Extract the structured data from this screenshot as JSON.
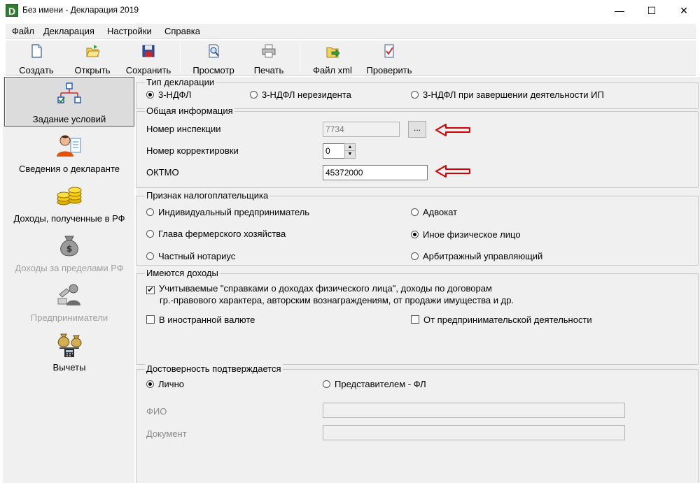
{
  "window": {
    "title": "Без имени - Декларация 2019",
    "icon_letter": "D",
    "minimize": "—",
    "maximize": "☐",
    "close": "✕"
  },
  "menu": [
    "Файл",
    "Декларация",
    "Настройки",
    "Справка"
  ],
  "toolbar": {
    "create": "Создать",
    "open": "Открыть",
    "save": "Сохранить",
    "preview": "Просмотр",
    "print": "Печать",
    "xml_file": "Файл xml",
    "check": "Проверить"
  },
  "nav": [
    {
      "label": "Задание условий",
      "icon": "structure-icon",
      "active": true,
      "disabled": false
    },
    {
      "label": "Сведения о декларанте",
      "icon": "person-icon",
      "active": false,
      "disabled": false
    },
    {
      "label": "Доходы, полученные в РФ",
      "icon": "coins-icon",
      "active": false,
      "disabled": false
    },
    {
      "label": "Доходы за пределами РФ",
      "icon": "money-bag-icon",
      "active": false,
      "disabled": true
    },
    {
      "label": "Предприниматели",
      "icon": "entrepreneur-icon",
      "active": false,
      "disabled": true
    },
    {
      "label": "Вычеты",
      "icon": "calculator-icon",
      "active": false,
      "disabled": false
    }
  ],
  "declaration_type": {
    "title": "Тип декларации",
    "options": [
      "3-НДФЛ",
      "3-НДФЛ нерезидента",
      "3-НДФЛ при завершении деятельности ИП"
    ],
    "selected": "3-НДФЛ"
  },
  "general_info": {
    "title": "Общая информация",
    "inspection_label": "Номер инспекции",
    "inspection_value": "7734",
    "browse_button": "...",
    "correction_label": "Номер корректировки",
    "correction_value": "0",
    "oktmo_label": "ОКТМО",
    "oktmo_value": "45372000",
    "annotation_color": "#d40000"
  },
  "taxpayer_type": {
    "title": "Признак налогоплательщика",
    "options": [
      "Индивидуальный предприниматель",
      "Адвокат",
      "Глава фермерского хозяйства",
      "Иное физическое лицо",
      "Частный нотариус",
      "Арбитражный управляющий"
    ],
    "selected": "Иное физическое лицо"
  },
  "incomes": {
    "title": "Имеются доходы",
    "certificate_line1": "Учитываемые \"справками о доходах физического лица\", доходы по договорам",
    "certificate_line2": "гр.-правового характера, авторским вознаграждениям, от продажи имущества и др.",
    "certificate_checked": true,
    "foreign_currency": "В иностранной валюте",
    "foreign_currency_checked": false,
    "business": "От предпринимательской деятельности",
    "business_checked": false
  },
  "authenticity": {
    "title": "Достоверность подтверждается",
    "personally": "Лично",
    "representative": "Представителем - ФЛ",
    "selected": "Лично",
    "fio_label": "ФИО",
    "document_label": "Документ",
    "fio_value": "",
    "document_value": ""
  }
}
